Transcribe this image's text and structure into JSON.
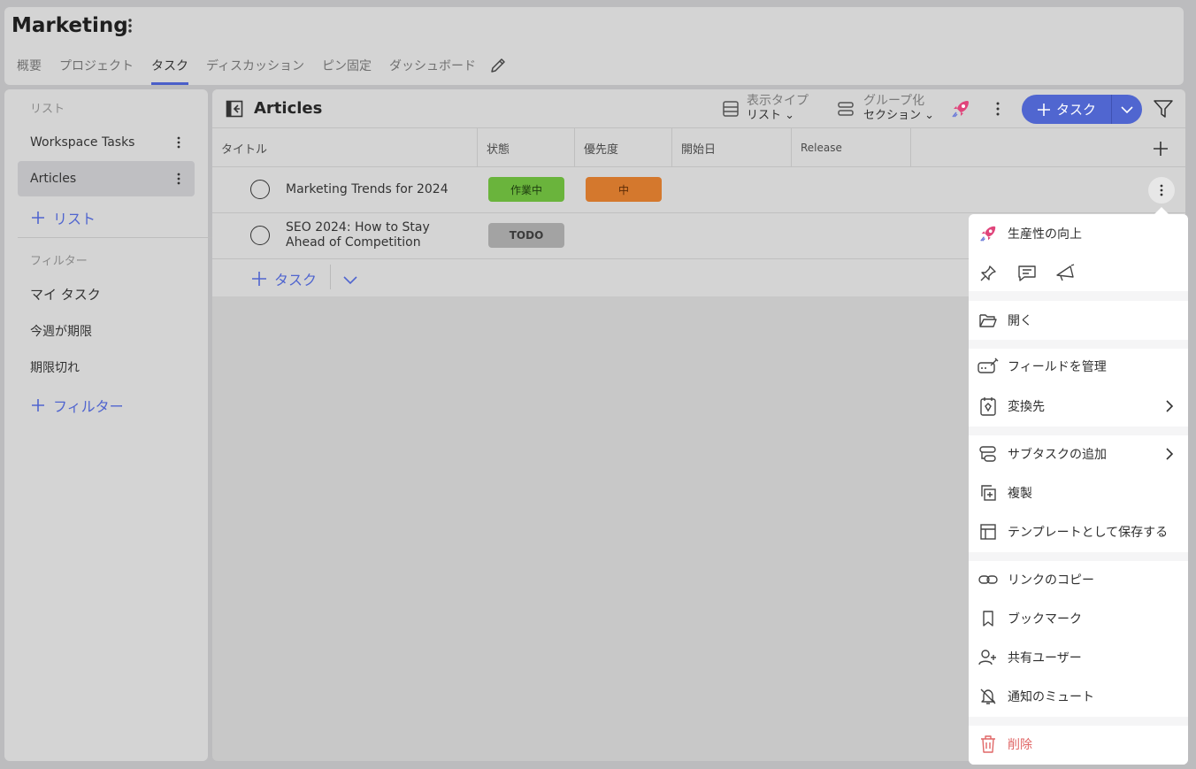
{
  "header": {
    "title": "Marketing",
    "tabs": [
      "概要",
      "プロジェクト",
      "タスク",
      "ディスカッション",
      "ピン固定",
      "ダッシュボード"
    ],
    "active_tab": "タスク"
  },
  "sidebar": {
    "lists_label": "リスト",
    "lists": [
      {
        "label": "Workspace Tasks",
        "selected": false
      },
      {
        "label": "Articles",
        "selected": true
      }
    ],
    "add_list": "リスト",
    "filters_label": "フィルター",
    "filters": [
      "マイ タスク",
      "今週が期限",
      "期限切れ"
    ],
    "add_filter": "フィルター"
  },
  "main": {
    "title": "Articles",
    "view_type_label": "表示タイプ",
    "view_type_value": "リスト",
    "group_label": "グループ化",
    "group_value": "セクション",
    "add_task": "タスク",
    "columns": [
      "タイトル",
      "状態",
      "優先度",
      "開始日",
      "Release"
    ],
    "tasks": [
      {
        "title": "Marketing Trends for 2024",
        "status": "作業中",
        "priority": "中"
      },
      {
        "title": "SEO 2024: How to Stay Ahead of Competition",
        "status": "TODO",
        "priority": ""
      }
    ],
    "add_row_task": "タスク"
  },
  "menu": {
    "productivity": "生産性の向上",
    "open": "開く",
    "manage_fields": "フィールドを管理",
    "convert_to": "変換先",
    "add_subtask": "サブタスクの追加",
    "duplicate": "複製",
    "save_template": "テンプレートとして保存する",
    "copy_link": "リンクのコピー",
    "bookmark": "ブックマーク",
    "shared_users": "共有ユーザー",
    "mute": "通知のミュート",
    "delete": "削除"
  },
  "colors": {
    "accent": "#5066d0",
    "status_in_progress": "#6ab43c",
    "status_todo": "#a3a3a3",
    "priority_medium": "#d4782d",
    "delete_red": "#e06666"
  }
}
